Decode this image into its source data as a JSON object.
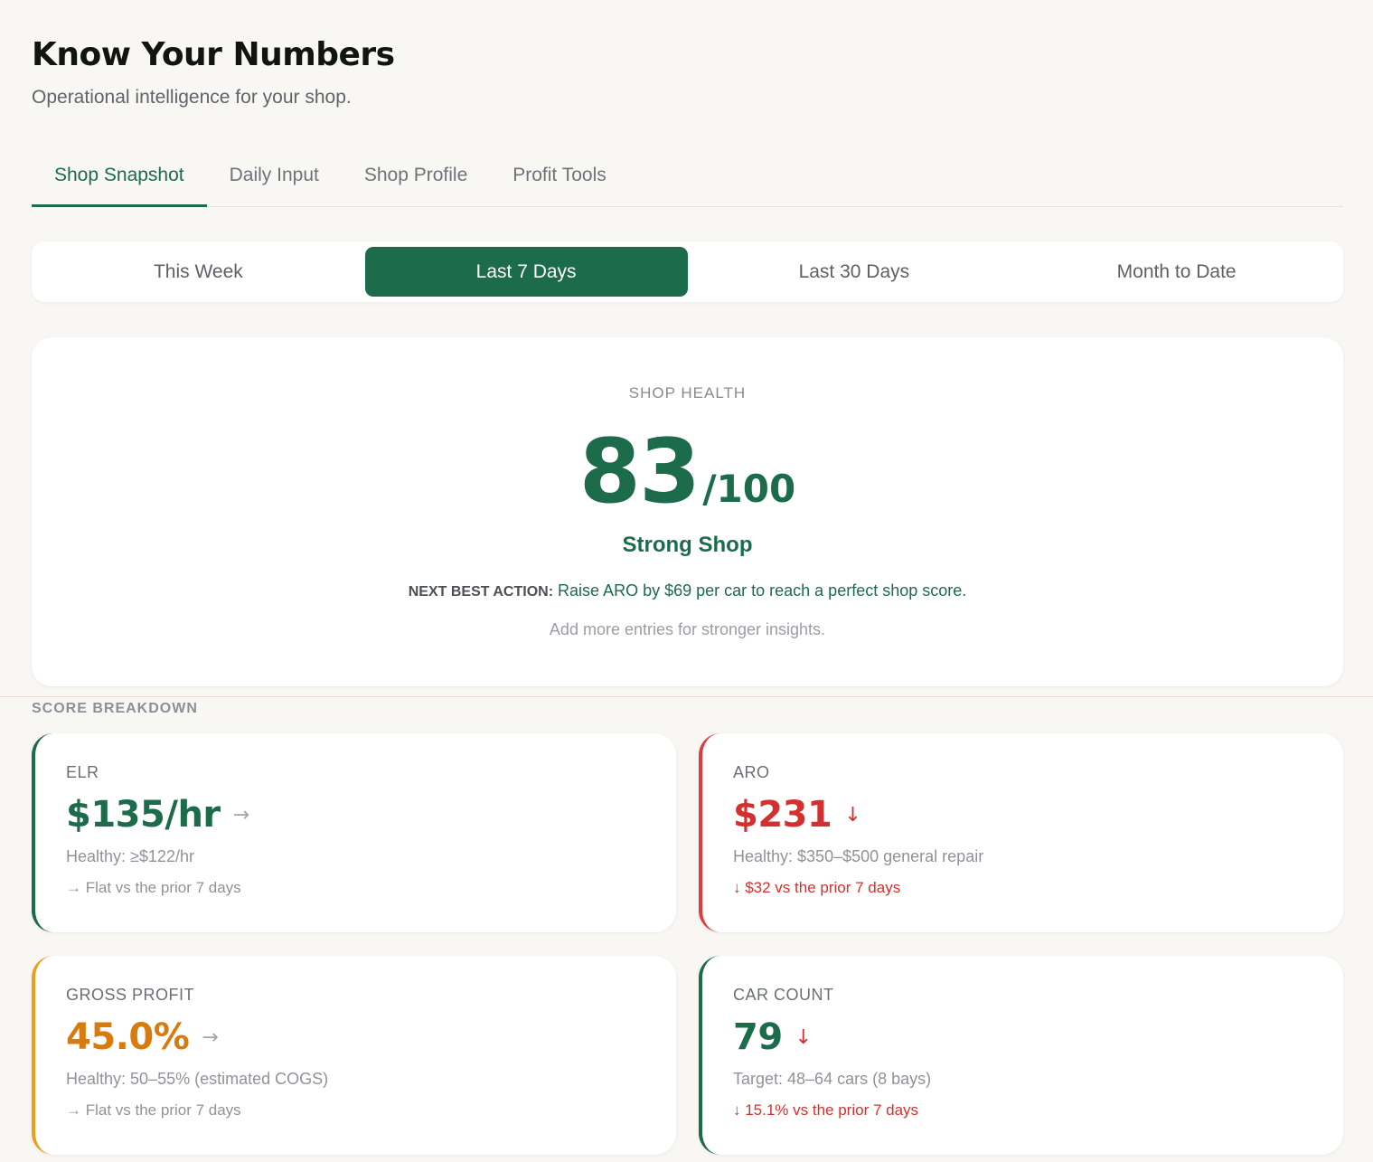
{
  "header": {
    "title": "Know Your Numbers",
    "subtitle": "Operational intelligence for your shop."
  },
  "tabs": [
    {
      "label": "Shop Snapshot",
      "active": true
    },
    {
      "label": "Daily Input",
      "active": false
    },
    {
      "label": "Shop Profile",
      "active": false
    },
    {
      "label": "Profit Tools",
      "active": false
    }
  ],
  "ranges": [
    {
      "label": "This Week",
      "active": false
    },
    {
      "label": "Last 7 Days",
      "active": true
    },
    {
      "label": "Last 30 Days",
      "active": false
    },
    {
      "label": "Month to Date",
      "active": false
    }
  ],
  "health": {
    "label": "SHOP HEALTH",
    "score": "83",
    "max": "/100",
    "status": "Strong Shop",
    "next_action_label": "NEXT BEST ACTION:",
    "next_action_text": " Raise ARO by $69 per car to reach a perfect shop score.",
    "note": "Add more entries for stronger insights."
  },
  "breakdown": {
    "label": "SCORE BREAKDOWN",
    "metrics": [
      {
        "name": "ELR",
        "value": "$135/hr",
        "trend_icon": "→",
        "healthy": "Healthy: ≥$122/hr",
        "change": "→ Flat vs the prior 7 days",
        "accent": "#1c6b4b"
      },
      {
        "name": "ARO",
        "value": "$231",
        "trend_icon": "↓",
        "healthy": "Healthy: $350–$500 general repair",
        "change": "↓ $32 vs the prior 7 days",
        "accent": "#e23b3b"
      },
      {
        "name": "GROSS PROFIT",
        "value": "45.0%",
        "trend_icon": "→",
        "healthy": "Healthy: 50–55% (estimated COGS)",
        "change": "→ Flat vs the prior 7 days",
        "accent": "#e8a21a"
      },
      {
        "name": "CAR COUNT",
        "value": "79",
        "trend_icon": "↓",
        "healthy": "Target: 48–64 cars (8 bays)",
        "change": "↓ 15.1% vs the prior 7 days",
        "accent": "#1c6b4b"
      }
    ]
  },
  "colors": {
    "brand_green": "#1c6b4b",
    "alert_red": "#d3312f",
    "warning_orange": "#d97a0c",
    "background": "#f8f7f4"
  }
}
